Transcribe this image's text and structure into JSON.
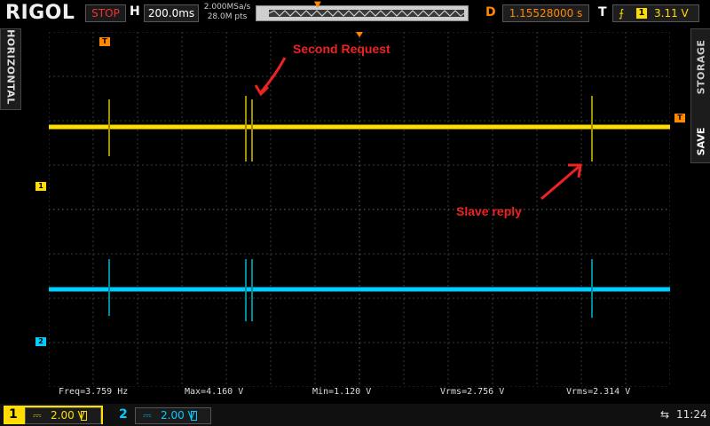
{
  "header": {
    "logo": "RIGOL",
    "run_status": "STOP",
    "horizontal_label": "H",
    "timebase": "200.0ms",
    "sample_rate": "2.000MSa/s",
    "memory_depth": "28.0M pts",
    "delay_label": "D",
    "delay_value": "1.15528000 s",
    "trigger_label": "T",
    "trigger_source": "1",
    "trigger_level": "3.11 V"
  },
  "side": {
    "left_tab": "HORIZONTAL",
    "right_tab_top": "STORAGE",
    "right_tab_bottom": "SAVE"
  },
  "markers": {
    "ch1": "1",
    "ch2": "2",
    "trigger": "T"
  },
  "annotations": {
    "second_request": "Second Request",
    "slave_reply": "Slave reply"
  },
  "measurements": {
    "freq": "Freq=3.759 Hz",
    "max": "Max=4.160 V",
    "min": "Min=1.120 V",
    "vrms1": "Vrms=2.756 V",
    "vrms2": "Vrms=2.314 V"
  },
  "channels": [
    {
      "number": "1",
      "scale": "2.00 V",
      "color": "#ffdd00"
    },
    {
      "number": "2",
      "scale": "2.00 V",
      "color": "#00ccff"
    }
  ],
  "status": {
    "time": "11:24",
    "usb_icon": "usb-icon"
  },
  "colors": {
    "ch1": "#ffdd00",
    "ch2": "#00ccff",
    "trigger": "#ff8800",
    "annotation": "#ee2222"
  }
}
